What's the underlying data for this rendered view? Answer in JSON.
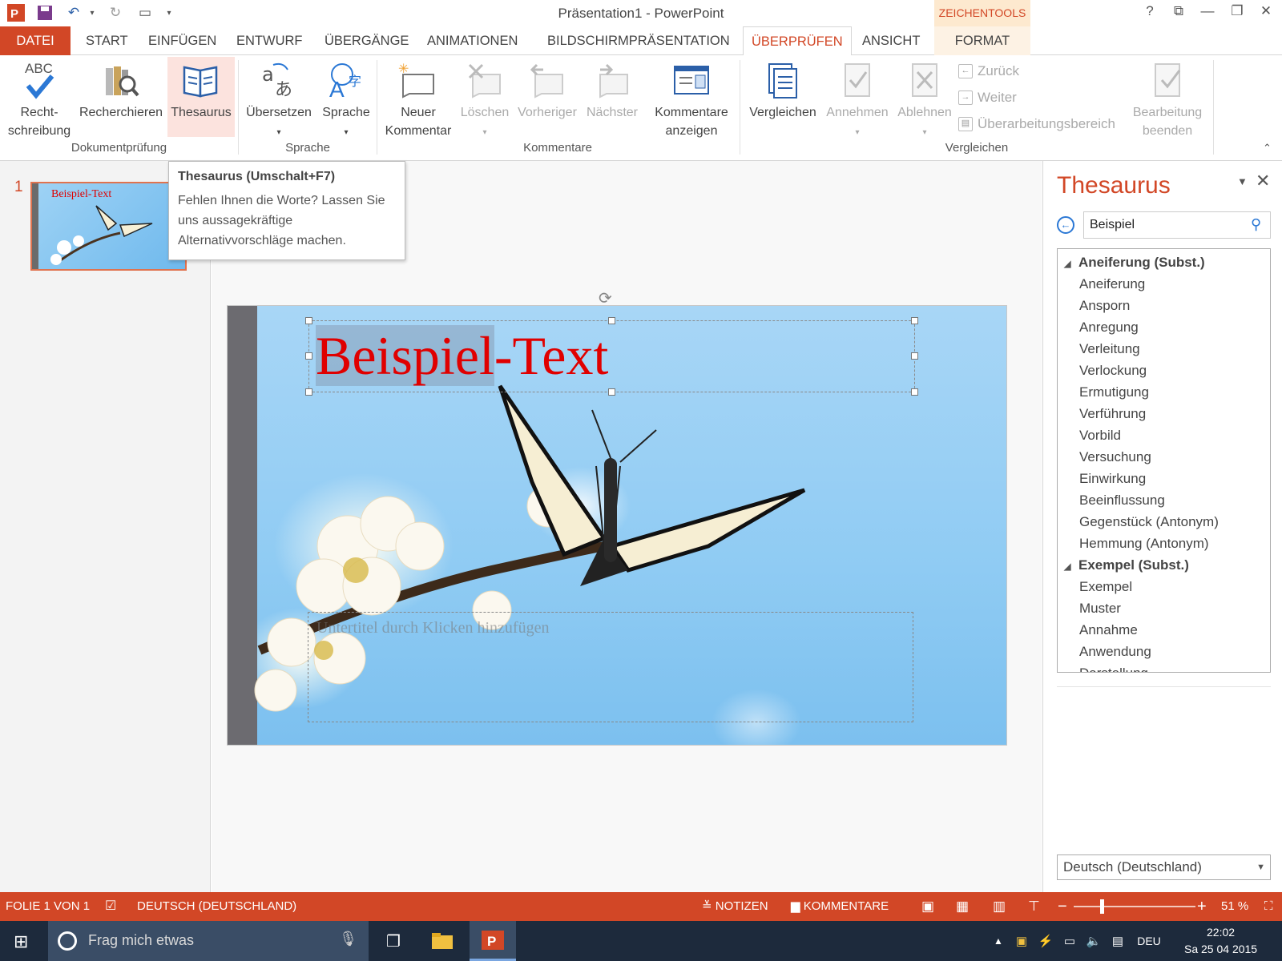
{
  "window": {
    "title": "Präsentation1 - PowerPoint",
    "contextual_tools": "ZEICHENTOOLS",
    "help": "?",
    "buttons": {
      "help": "?",
      "restore": "⧉",
      "minimize": "—",
      "maximize": "❐",
      "close": "✕"
    }
  },
  "tabs": [
    "DATEI",
    "START",
    "EINFÜGEN",
    "ENTWURF",
    "ÜBERGÄNGE",
    "ANIMATIONEN",
    "BILDSCHIRMPRÄSENTATION",
    "ÜBERPRÜFEN",
    "ANSICHT",
    "FORMAT"
  ],
  "active_tab": "ÜBERPRÜFEN",
  "ribbon": {
    "proofing": {
      "spelling": "Recht-\nschreibung",
      "research": "Recherchieren",
      "thesaurus": "Thesaurus",
      "group": "Dokumentprüfung",
      "abc": "ABC"
    },
    "language": {
      "translate": "Übersetzen",
      "language": "Sprache",
      "group": "Sprache"
    },
    "comments": {
      "new": "Neuer\nKommentar",
      "delete": "Löschen",
      "previous": "Vorheriger",
      "next": "Nächster",
      "show": "Kommentare\nanzeigen",
      "group": "Kommentare"
    },
    "compare": {
      "compare": "Vergleichen",
      "accept": "Annehmen",
      "reject": "Ablehnen",
      "back": "Zurück",
      "forward": "Weiter",
      "pane": "Überarbeitungsbereich",
      "end": "Bearbeitung\nbeenden",
      "group": "Vergleichen"
    }
  },
  "tooltip": {
    "title": "Thesaurus (Umschalt+F7)",
    "body": "Fehlen Ihnen die Worte? Lassen Sie uns aussagekräftige Alternativvorschläge machen."
  },
  "slides_panel": {
    "number": "1",
    "thumb_title": "Beispiel-Text"
  },
  "slide": {
    "title_selected": "Beispiel",
    "title_rest": "-Text",
    "subtitle_placeholder": "Untertitel durch Klicken hinzufügen"
  },
  "thesaurus": {
    "title": "Thesaurus",
    "search_value": "Beispiel",
    "groups": [
      {
        "heading": "Aneiferung (Subst.)",
        "items": [
          "Aneiferung",
          "Ansporn",
          "Anregung",
          "Verleitung",
          "Verlockung",
          "Ermutigung",
          "Verführung",
          "Vorbild",
          "Versuchung",
          "Einwirkung",
          "Beeinflussung",
          "Gegenstück (Antonym)",
          "Hemmung (Antonym)"
        ]
      },
      {
        "heading": "Exempel (Subst.)",
        "items": [
          "Exempel",
          "Muster",
          "Annahme",
          "Anwendung",
          "Darstellung"
        ]
      }
    ],
    "language": "Deutsch (Deutschland)"
  },
  "statusbar": {
    "slide_info": "FOLIE 1 VON 1",
    "language": "DEUTSCH (DEUTSCHLAND)",
    "notes": "NOTIZEN",
    "comments": "KOMMENTARE",
    "zoom": "51 %",
    "zoom_level": 0.51
  },
  "taskbar": {
    "search_placeholder": "Frag mich etwas",
    "lang": "DEU",
    "time": "22:02",
    "date": "Sa 25 04 2015"
  },
  "colors": {
    "accent": "#d24726",
    "title_red": "#e00000",
    "link_blue": "#2b78d5"
  }
}
